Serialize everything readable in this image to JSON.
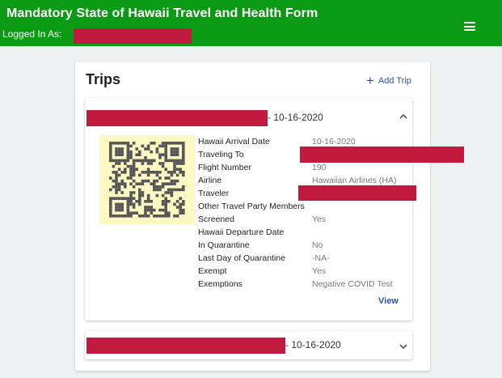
{
  "appbar": {
    "title": "Mandatory State of Hawaii Travel and Health Form",
    "logged_in_label": "Logged In As:",
    "menu_icon": "hamburger-menu-icon",
    "color": "#0b9a14"
  },
  "trips_card": {
    "title": "Trips",
    "add_trip_label": "Add Trip",
    "add_icon": "plus-icon",
    "link_color": "#2b53b3",
    "redaction_color": "#c2193f"
  },
  "trips": [
    {
      "date_suffix": "- 10-16-2020",
      "expanded": true,
      "chevron_icon": "chevron-up-icon",
      "qr_icon": "qr-code-icon",
      "details": [
        {
          "label": "Hawaii Arrival Date",
          "value": "10-16-2020"
        },
        {
          "label": "Traveling To",
          "value": ""
        },
        {
          "label": "Flight Number",
          "value": "190"
        },
        {
          "label": "Airline",
          "value": "Hawaiian Airlines (HA)"
        },
        {
          "label": "Traveler",
          "value": ""
        },
        {
          "label": "Other Travel Party Members",
          "value": ""
        },
        {
          "label": "Screened",
          "value": "Yes"
        },
        {
          "label": "Hawaii Departure Date",
          "value": ""
        },
        {
          "label": "In Quarantine",
          "value": "No"
        },
        {
          "label": "Last Day of Quarantine",
          "value": "-NA-"
        },
        {
          "label": "Exempt",
          "value": "Yes"
        },
        {
          "label": "Exemptions",
          "value": "Negative COVID Test"
        }
      ],
      "view_label": "View"
    },
    {
      "date_suffix": "- 10-16-2020",
      "expanded": false,
      "chevron_icon": "chevron-down-icon"
    }
  ]
}
